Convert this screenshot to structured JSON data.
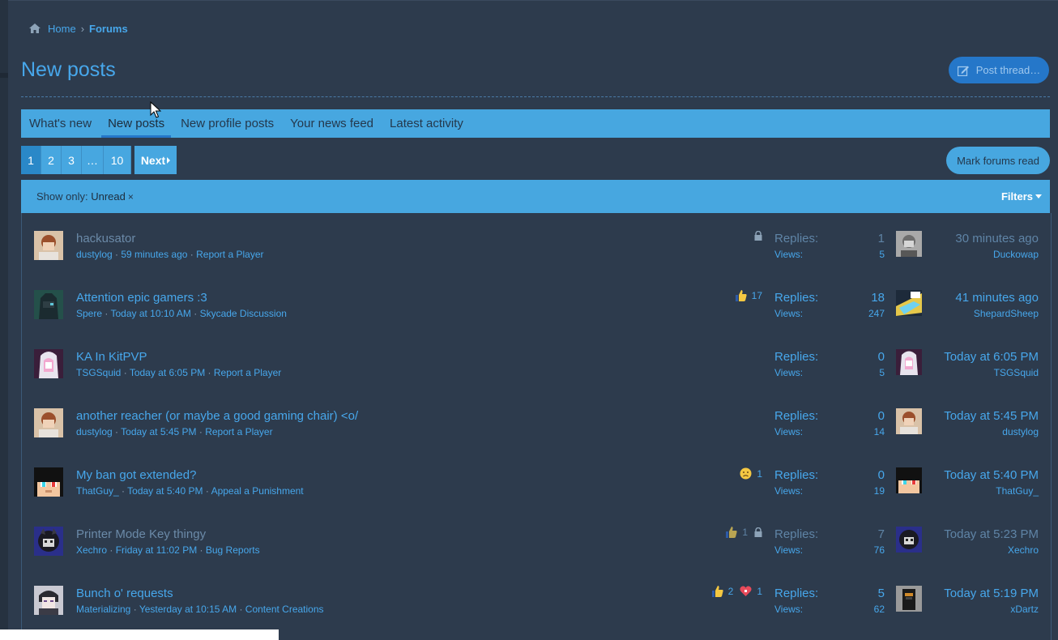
{
  "breadcrumb": {
    "home": "Home",
    "current": "Forums"
  },
  "page_title": "New posts",
  "post_thread_label": "Post thread…",
  "tabs": [
    {
      "label": "What's new"
    },
    {
      "label": "New posts"
    },
    {
      "label": "New profile posts"
    },
    {
      "label": "Your news feed"
    },
    {
      "label": "Latest activity"
    }
  ],
  "pagination": {
    "pages": [
      "1",
      "2",
      "3",
      "…",
      "10"
    ],
    "current": "1",
    "next_label": "Next"
  },
  "mark_read_label": "Mark forums read",
  "filter": {
    "label": "Show only:",
    "value": "Unread",
    "remove": "×",
    "filters_label": "Filters"
  },
  "threads": [
    {
      "title": "hackusator",
      "author": "dustylog",
      "when": "59 minutes ago",
      "forum": "Report a Player",
      "replies_label": "Replies:",
      "replies": "1",
      "views_label": "Views:",
      "views": "5",
      "last_when": "30 minutes ago",
      "last_user": "Duckowap",
      "read": true,
      "locked": true
    },
    {
      "title": "Attention epic gamers :3",
      "author": "Spere",
      "when": "Today at 10:10 AM",
      "forum": "Skycade Discussion",
      "replies_label": "Replies:",
      "replies": "18",
      "views_label": "Views:",
      "views": "247",
      "last_when": "41 minutes ago",
      "last_user": "ShepardSheep",
      "like_count": "17"
    },
    {
      "title": "KA In KitPVP",
      "author": "TSGSquid",
      "when": "Today at 6:05 PM",
      "forum": "Report a Player",
      "replies_label": "Replies:",
      "replies": "0",
      "views_label": "Views:",
      "views": "5",
      "last_when": "Today at 6:05 PM",
      "last_user": "TSGSquid"
    },
    {
      "title": "another reacher (or maybe a good gaming chair) <o/",
      "author": "dustylog",
      "when": "Today at 5:45 PM",
      "forum": "Report a Player",
      "replies_label": "Replies:",
      "replies": "0",
      "views_label": "Views:",
      "views": "14",
      "last_when": "Today at 5:45 PM",
      "last_user": "dustylog"
    },
    {
      "title": "My ban got extended?",
      "author": "ThatGuy_",
      "when": "Today at 5:40 PM",
      "forum": "Appeal a Punishment",
      "replies_label": "Replies:",
      "replies": "0",
      "views_label": "Views:",
      "views": "19",
      "last_when": "Today at 5:40 PM",
      "last_user": "ThatGuy_",
      "sad_count": "1"
    },
    {
      "title": "Printer Mode Key thingy",
      "author": "Xechro",
      "when": "Friday at 11:02 PM",
      "forum": "Bug Reports",
      "replies_label": "Replies:",
      "replies": "7",
      "views_label": "Views:",
      "views": "76",
      "last_when": "Today at 5:23 PM",
      "last_user": "Xechro",
      "read": true,
      "locked": true,
      "like_count": "1"
    },
    {
      "title": "Bunch o' requests",
      "author": "Materializing",
      "when": "Yesterday at 10:15 AM",
      "forum": "Content Creations",
      "replies_label": "Replies:",
      "replies": "5",
      "views_label": "Views:",
      "views": "62",
      "last_when": "Today at 5:19 PM",
      "last_user": "xDartz",
      "like_count": "2",
      "love_count": "1"
    }
  ],
  "colors": {
    "background": "#2d3b4d",
    "accent": "#47a7e0",
    "link": "#47a7eb",
    "button": "#2577c9"
  }
}
